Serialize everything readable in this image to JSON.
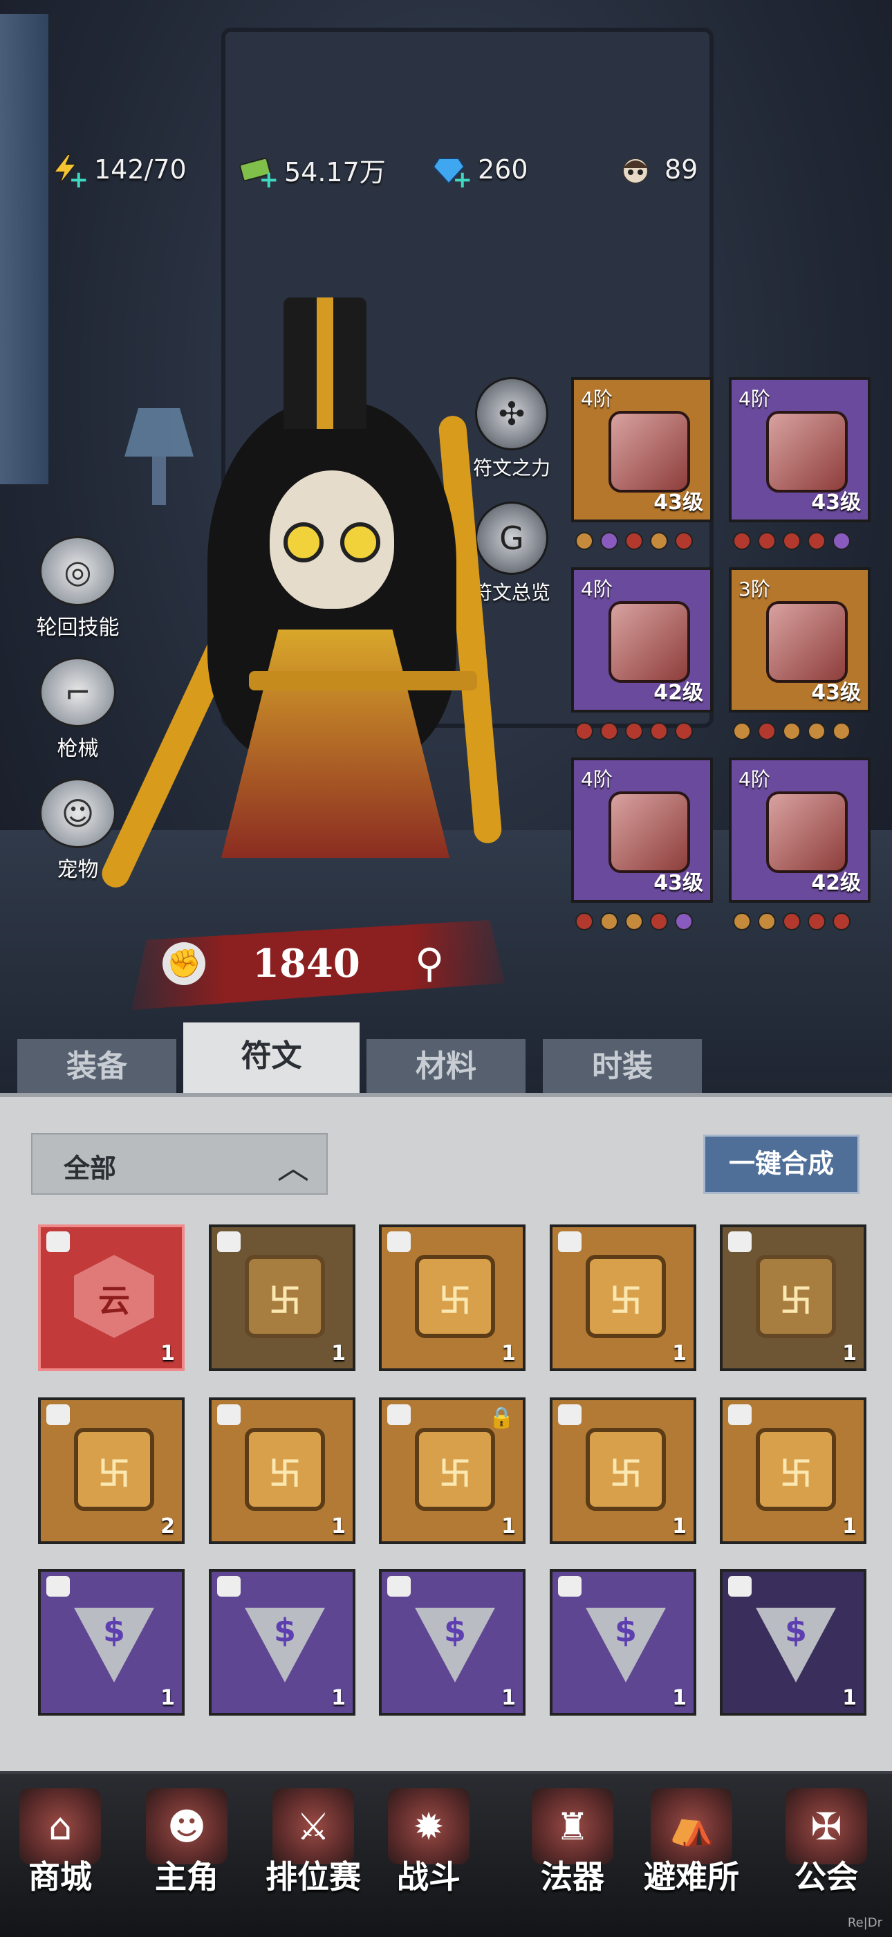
{
  "resources": [
    {
      "name": "stamina",
      "icon": "lightning-icon",
      "value": "142/70"
    },
    {
      "name": "money",
      "icon": "cash-icon",
      "value": "54.17万"
    },
    {
      "name": "gems",
      "icon": "diamond-icon",
      "value": "260"
    },
    {
      "name": "avatar",
      "icon": "character-head-icon",
      "value": "89"
    }
  ],
  "side_buttons": [
    "轮回技能",
    "枪械",
    "宠物"
  ],
  "rune_buttons": [
    "符文之力",
    "符文总览"
  ],
  "power": "1840",
  "equipment": [
    {
      "tier": "4阶",
      "level": "43级",
      "rarity": "gold",
      "item": "cap"
    },
    {
      "tier": "4阶",
      "level": "43级",
      "rarity": "purple",
      "item": "armband"
    },
    {
      "tier": "4阶",
      "level": "42级",
      "rarity": "purple",
      "item": "jacket"
    },
    {
      "tier": "3阶",
      "level": "43级",
      "rarity": "gold",
      "item": "pants"
    },
    {
      "tier": "4阶",
      "level": "43级",
      "rarity": "purple",
      "item": "shoes"
    },
    {
      "tier": "4阶",
      "level": "42级",
      "rarity": "purple",
      "item": "gloves"
    }
  ],
  "equipment_dots": [
    [
      "#c58a3c",
      "#8a5bbf",
      "#b3392f",
      "#c58a3c",
      "#b3392f"
    ],
    [
      "#b3392f",
      "#b3392f",
      "#b3392f",
      "#b3392f",
      "#8a5bbf"
    ],
    [
      "#b3392f",
      "#b3392f",
      "#b3392f",
      "#b3392f",
      "#b3392f"
    ],
    [
      "#c58a3c",
      "#b3392f",
      "#c58a3c",
      "#c58a3c",
      "#c58a3c"
    ],
    [
      "#b3392f",
      "#c58a3c",
      "#c58a3c",
      "#b3392f",
      "#8a5bbf"
    ],
    [
      "#c58a3c",
      "#c58a3c",
      "#b3392f",
      "#b3392f",
      "#b3392f"
    ]
  ],
  "tabs": [
    "装备",
    "符文",
    "材料",
    "时装"
  ],
  "active_tab": "符文",
  "filter_label": "全部",
  "synth_button": "一键合成",
  "runes": [
    {
      "rarity": "red",
      "glyph": "云",
      "count": "1"
    },
    {
      "rarity": "dim",
      "glyph": "卐",
      "count": "1"
    },
    {
      "rarity": "gold",
      "glyph": "卐",
      "count": "1"
    },
    {
      "rarity": "gold",
      "glyph": "卐",
      "count": "1"
    },
    {
      "rarity": "dim",
      "glyph": "卐",
      "count": "1"
    },
    {
      "rarity": "gold",
      "glyph": "卐",
      "count": "2"
    },
    {
      "rarity": "gold",
      "glyph": "卐",
      "count": "1"
    },
    {
      "rarity": "gold",
      "glyph": "卐",
      "count": "1",
      "locked": true
    },
    {
      "rarity": "gold",
      "glyph": "卐",
      "count": "1"
    },
    {
      "rarity": "gold",
      "glyph": "卐",
      "count": "1"
    },
    {
      "rarity": "purple",
      "glyph": "$",
      "count": "1"
    },
    {
      "rarity": "purple",
      "glyph": "$",
      "count": "1"
    },
    {
      "rarity": "purple",
      "glyph": "$",
      "count": "1"
    },
    {
      "rarity": "purple",
      "glyph": "$",
      "count": "1"
    },
    {
      "rarity": "dimp",
      "glyph": "$",
      "count": "1"
    }
  ],
  "nav": [
    {
      "label": "商城",
      "icon": "shop-icon"
    },
    {
      "label": "主角",
      "icon": "hero-icon",
      "active": true
    },
    {
      "label": "排位赛",
      "icon": "crossed-weapons-icon"
    },
    {
      "label": "战斗",
      "icon": "battle-icon"
    },
    {
      "label": "法器",
      "icon": "bell-icon"
    },
    {
      "label": "避难所",
      "icon": "tent-icon"
    },
    {
      "label": "公会",
      "icon": "guild-icon"
    }
  ],
  "watermark": "Re|Dr"
}
